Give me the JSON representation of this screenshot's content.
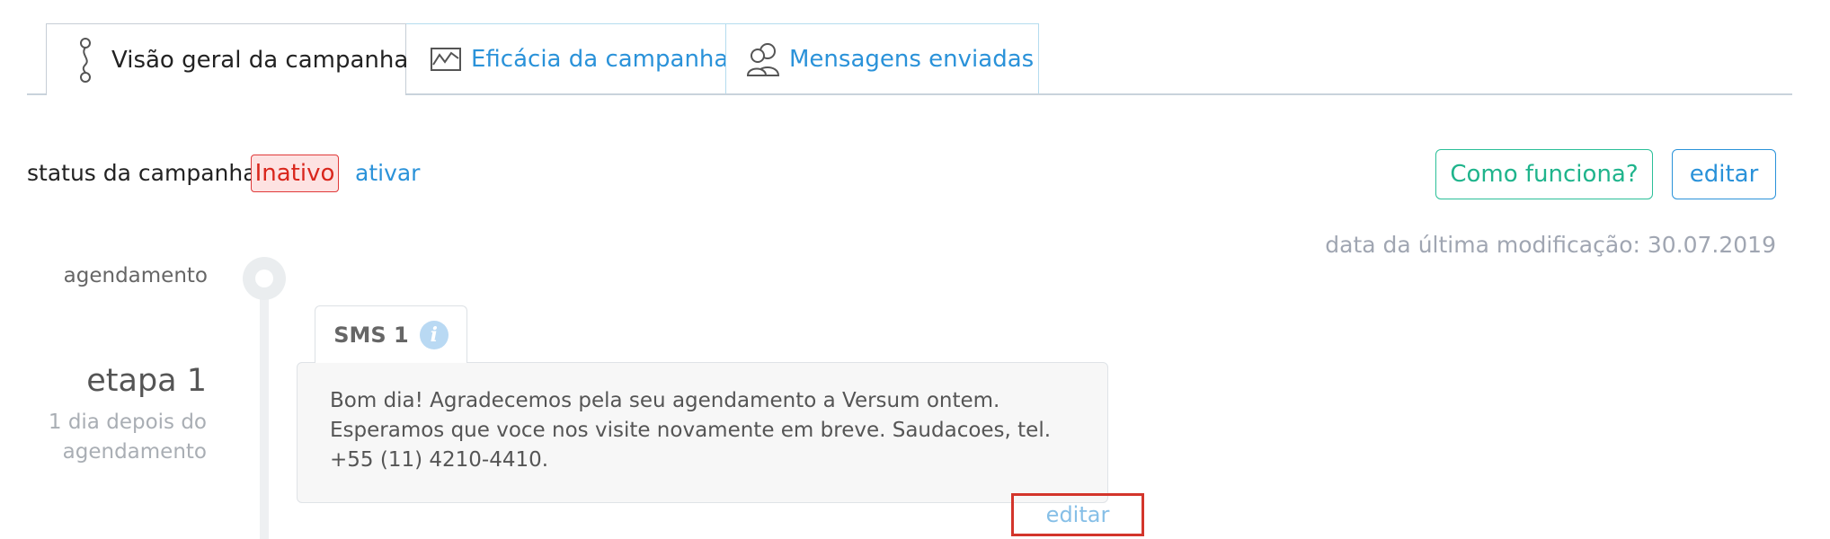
{
  "tabs": [
    {
      "label": "Visão geral da campanha",
      "icon": "campaign-flow-icon",
      "active": true
    },
    {
      "label": "Eficácia da campanha",
      "icon": "chart-icon",
      "active": false
    },
    {
      "label": "Mensagens enviadas",
      "icon": "users-icon",
      "active": false
    }
  ],
  "status": {
    "label": "status da campanha:",
    "badge": "Inativo",
    "activate_link": "ativar"
  },
  "actions": {
    "how_it_works": "Como funciona?",
    "edit": "editar"
  },
  "last_modified": "data da última modificação: 30.07.2019",
  "timeline": {
    "schedule_label": "agendamento",
    "stage_title": "etapa 1",
    "stage_subtitle_line1": "1 dia depois do",
    "stage_subtitle_line2": "agendamento"
  },
  "sms": {
    "tab_label": "SMS 1",
    "info_icon": "info-icon",
    "message": "Bom dia! Agradecemos pela seu agendamento a Versum ontem. Esperamos que voce nos visite novamente em breve. Saudacoes, tel. +55 (11) 4210-4410.",
    "edit_link": "editar"
  },
  "colors": {
    "link": "#2a92d9",
    "accent_green": "#1fb48c",
    "inactive_red": "#d9261c",
    "highlight_box": "#d3352b"
  }
}
